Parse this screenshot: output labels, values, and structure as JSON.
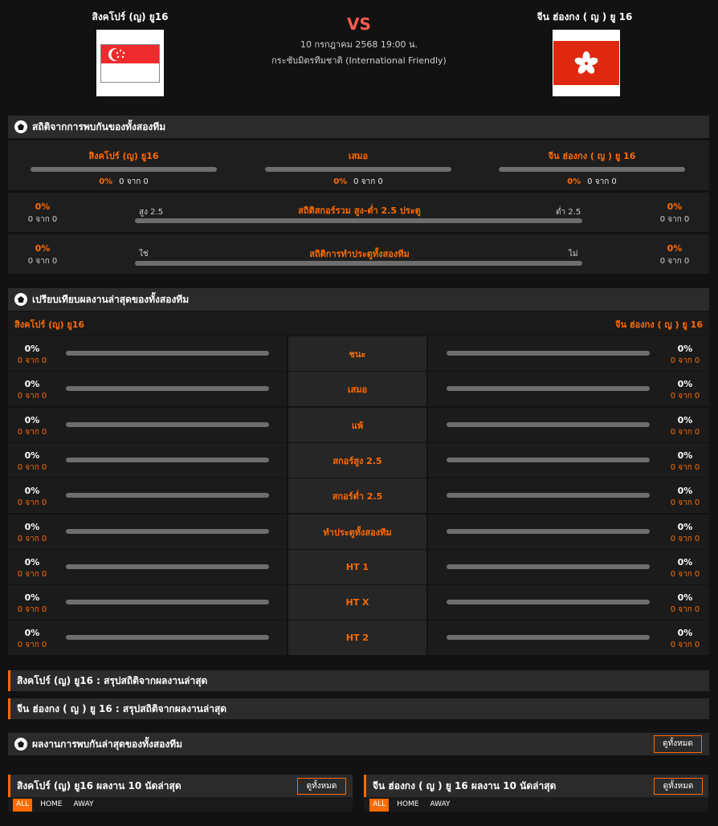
{
  "match": {
    "home_team": "สิงคโปร์ (ญ) ยู16",
    "away_team": "จีน ฮ่องกง ( ญ ) ยู 16",
    "vs": "VS",
    "datetime": "10 กรกฎาคม 2568 19:00 น.",
    "competition": "กระชับมิตรทีมชาติ (International Friendly)",
    "home_flag": "singapore-flag",
    "away_flag": "hong-kong-flag"
  },
  "h2h": {
    "title": "สถิติจากการพบกันของทั้งสองทีม",
    "columns": [
      {
        "label": "สิงคโปร์ (ญ) ยู16",
        "pct": "0%",
        "count": "0 จาก 0"
      },
      {
        "label": "เสมอ",
        "pct": "0%",
        "count": "0 จาก 0"
      },
      {
        "label": "จีน ฮ่องกง ( ญ ) ยู 16",
        "pct": "0%",
        "count": "0 จาก 0"
      }
    ],
    "over_under": {
      "title": "สถิติสกอร์รวม สูง-ต่ำ 2.5 ประตู",
      "left_label": "สูง 2.5",
      "right_label": "ต่ำ 2.5",
      "left_pct": "0%",
      "left_count": "0 จาก 0",
      "right_pct": "0%",
      "right_count": "0 จาก 0"
    },
    "btts": {
      "title": "สถิติการทำประตูทั้งสองทีม",
      "left_label": "ใช่",
      "right_label": "ไม่",
      "left_pct": "0%",
      "left_count": "0 จาก 0",
      "right_pct": "0%",
      "right_count": "0 จาก 0"
    }
  },
  "compare": {
    "title": "เปรียบเทียบผลงานล่าสุดของทั้งสองทีม",
    "home_team": "สิงคโปร์ (ญ) ยู16",
    "away_team": "จีน ฮ่องกง ( ญ ) ยู 16",
    "rows": [
      {
        "label": "ชนะ",
        "home_pct": "0%",
        "home_count": "0 จาก 0",
        "away_pct": "0%",
        "away_count": "0 จาก 0"
      },
      {
        "label": "เสมอ",
        "home_pct": "0%",
        "home_count": "0 จาก 0",
        "away_pct": "0%",
        "away_count": "0 จาก 0"
      },
      {
        "label": "แพ้",
        "home_pct": "0%",
        "home_count": "0 จาก 0",
        "away_pct": "0%",
        "away_count": "0 จาก 0"
      },
      {
        "label": "สกอร์สูง 2.5",
        "home_pct": "0%",
        "home_count": "0 จาก 0",
        "away_pct": "0%",
        "away_count": "0 จาก 0"
      },
      {
        "label": "สกอร์ต่ำ 2.5",
        "home_pct": "0%",
        "home_count": "0 จาก 0",
        "away_pct": "0%",
        "away_count": "0 จาก 0"
      },
      {
        "label": "ทำประตูทั้งสองทีม",
        "home_pct": "0%",
        "home_count": "0 จาก 0",
        "away_pct": "0%",
        "away_count": "0 จาก 0"
      },
      {
        "label": "HT 1",
        "home_pct": "0%",
        "home_count": "0 จาก 0",
        "away_pct": "0%",
        "away_count": "0 จาก 0"
      },
      {
        "label": "HT X",
        "home_pct": "0%",
        "home_count": "0 จาก 0",
        "away_pct": "0%",
        "away_count": "0 จาก 0"
      },
      {
        "label": "HT 2",
        "home_pct": "0%",
        "home_count": "0 จาก 0",
        "away_pct": "0%",
        "away_count": "0 จาก 0"
      }
    ]
  },
  "summaries": {
    "home": "สิงคโปร์ (ญ) ยู16 : สรุปสถิติจากผลงานล่าสุด",
    "away": "จีน ฮ่องกง ( ญ ) ยู 16 : สรุปสถิติจากผลงานล่าสุด"
  },
  "recent_h2h": {
    "title": "ผลงานการพบกันล่าสุดของทั้งสองทีม",
    "view_all": "ดูทั้งหมด"
  },
  "recent_form": {
    "home_title": "สิงคโปร์ (ญ) ยู16 ผลงาน 10 นัดล่าสุด",
    "away_title": "จีน ฮ่องกง ( ญ ) ยู 16 ผลงาน 10 นัดล่าสุด",
    "view_all": "ดูทั้งหมด",
    "tabs": [
      "ALL",
      "HOME",
      "AWAY"
    ]
  },
  "colors": {
    "accent": "#ff6a00",
    "background": "#121212",
    "vs": "#ff5a4e"
  }
}
